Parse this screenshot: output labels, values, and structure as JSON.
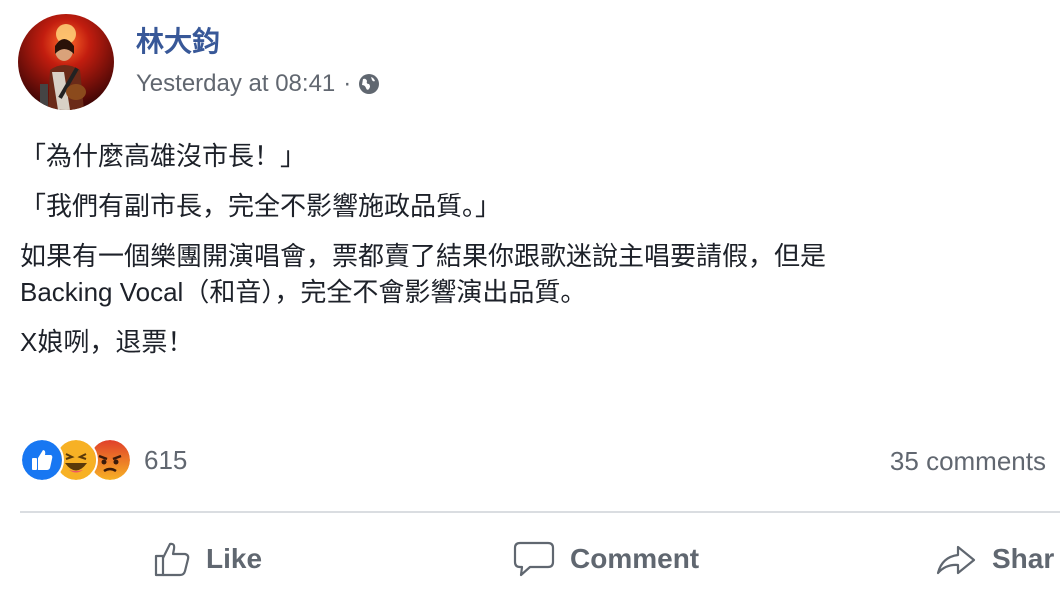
{
  "author": {
    "name": "林大鈞",
    "avatar_icon": "guitarist-avatar"
  },
  "meta": {
    "timestamp": "Yesterday at 08:41",
    "separator": "·",
    "privacy_icon": "globe-icon"
  },
  "post": {
    "paragraphs": [
      "「為什麼高雄沒市長！」",
      "「我們有副市長，完全不影響施政品質。」",
      "如果有一個樂團開演唱會，票都賣了結果你跟歌迷說主唱要請假，但是",
      "Backing Vocal（和音），完全不會影響演出品質。",
      "X娘咧，退票！"
    ]
  },
  "engagement": {
    "reaction_icons": [
      "like-reaction-icon",
      "haha-reaction-icon",
      "angry-reaction-icon"
    ],
    "reaction_count": "615",
    "comments": "35 comments"
  },
  "actions": {
    "like_label": "Like",
    "comment_label": "Comment",
    "share_label": "Shar"
  },
  "colors": {
    "author_link": "#385898",
    "secondary_text": "#616770",
    "like_blue": "#1877f2",
    "haha_yellow": "#f7b125",
    "angry_orange": "#e9710f",
    "divider": "#dadde1"
  }
}
